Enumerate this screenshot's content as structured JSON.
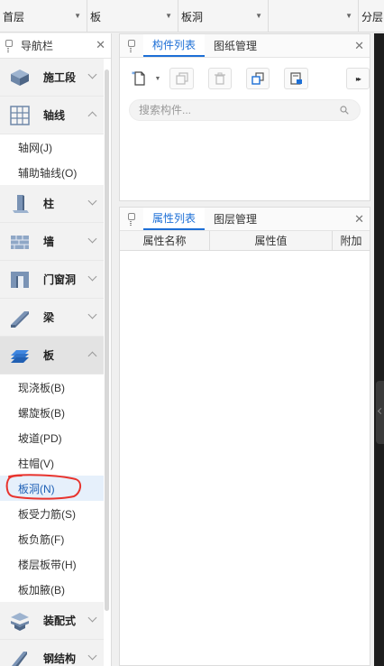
{
  "topbar": {
    "floor": "首层",
    "type": "板",
    "subtype": "板洞",
    "extra": "",
    "layer": "分层"
  },
  "nav": {
    "title": "导航栏",
    "categories": [
      {
        "label": "施工段",
        "icon": "construction-stage-icon",
        "expanded": false
      },
      {
        "label": "轴线",
        "icon": "axis-grid-icon",
        "expanded": true,
        "items": [
          "轴网(J)",
          "辅助轴线(O)"
        ]
      },
      {
        "label": "柱",
        "icon": "column-icon",
        "expanded": false
      },
      {
        "label": "墙",
        "icon": "wall-icon",
        "expanded": false
      },
      {
        "label": "门窗洞",
        "icon": "door-window-icon",
        "expanded": false
      },
      {
        "label": "梁",
        "icon": "beam-icon",
        "expanded": false
      },
      {
        "label": "板",
        "icon": "slab-icon",
        "expanded": true,
        "items": [
          "现浇板(B)",
          "螺旋板(B)",
          "坡道(PD)",
          "柱帽(V)",
          "板洞(N)",
          "板受力筋(S)",
          "板负筋(F)",
          "楼层板带(H)",
          "板加腋(B)"
        ]
      },
      {
        "label": "装配式",
        "icon": "prefab-icon",
        "expanded": false
      },
      {
        "label": "钢结构",
        "icon": "steel-structure-icon",
        "expanded": false
      }
    ],
    "selected_item": "板洞(N)"
  },
  "component_panel": {
    "tabs": [
      "构件列表",
      "图纸管理"
    ],
    "active_tab": "构件列表",
    "search_placeholder": "搜索构件..."
  },
  "property_panel": {
    "tabs": [
      "属性列表",
      "图层管理"
    ],
    "active_tab": "属性列表",
    "columns": [
      "属性名称",
      "属性值",
      "附加"
    ]
  },
  "colors": {
    "accent": "#1d6fd6",
    "annotation": "#e8342e",
    "selected_bg": "#e6f0fb"
  }
}
